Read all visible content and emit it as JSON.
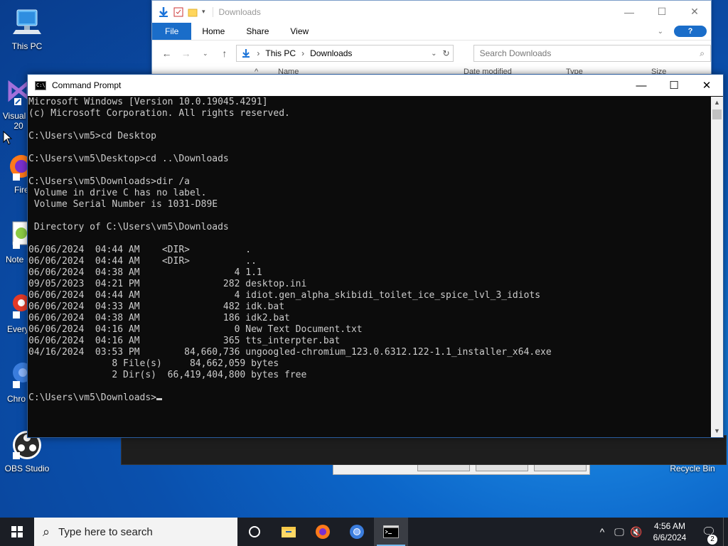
{
  "desktop": {
    "icons": [
      {
        "label": "This PC",
        "icon": "this-pc-icon"
      },
      {
        "label": "Visual",
        "label2": "20",
        "icon": "visual-studio-icon"
      },
      {
        "label": "Fire",
        "icon": "firefox-icon"
      },
      {
        "label": "Note",
        "icon": "notepadpp-icon"
      },
      {
        "label": "Every",
        "icon": "everything-icon"
      },
      {
        "label": "Chro",
        "icon": "chrome-icon"
      },
      {
        "label": "OBS Studio",
        "icon": "obs-icon"
      },
      {
        "label": "Recycle Bin",
        "icon": "recycle-bin-icon"
      }
    ]
  },
  "explorer": {
    "title": "Downloads",
    "tabs": [
      "File",
      "Home",
      "Share",
      "View"
    ],
    "breadcrumb": [
      "This PC",
      "Downloads"
    ],
    "search_placeholder": "Search Downloads",
    "columns": [
      "Name",
      "Date modified",
      "Type",
      "Size"
    ]
  },
  "cmd": {
    "title": "Command Prompt",
    "icon_text": "C:\\",
    "lines": [
      "Microsoft Windows [Version 10.0.19045.4291]",
      "(c) Microsoft Corporation. All rights reserved.",
      "",
      "C:\\Users\\vm5>cd Desktop",
      "",
      "C:\\Users\\vm5\\Desktop>cd ..\\Downloads",
      "",
      "C:\\Users\\vm5\\Downloads>dir /a",
      " Volume in drive C has no label.",
      " Volume Serial Number is 1031-D89E",
      "",
      " Directory of C:\\Users\\vm5\\Downloads",
      "",
      "06/06/2024  04:44 AM    <DIR>          .",
      "06/06/2024  04:44 AM    <DIR>          ..",
      "06/06/2024  04:38 AM                 4 1.1",
      "09/05/2023  04:21 PM               282 desktop.ini",
      "06/06/2024  04:44 AM                 4 idiot.gen_alpha_skibidi_toilet_ice_spice_lvl_3_idiots",
      "06/06/2024  04:33 AM               482 idk.bat",
      "06/06/2024  04:38 AM               186 idk2.bat",
      "06/06/2024  04:16 AM                 0 New Text Document.txt",
      "06/06/2024  04:16 AM               365 tts_interpter.bat",
      "04/16/2024  03:53 PM        84,660,736 ungoogled-chromium_123.0.6312.122-1.1_installer_x64.exe",
      "               8 File(s)     84,662,059 bytes",
      "               2 Dir(s)  66,419,404,800 bytes free",
      ""
    ],
    "prompt": "C:\\Users\\vm5\\Downloads>"
  },
  "taskbar": {
    "search_placeholder": "Type here to search",
    "time": "4:56 AM",
    "date": "6/6/2024",
    "notification_count": "2"
  }
}
